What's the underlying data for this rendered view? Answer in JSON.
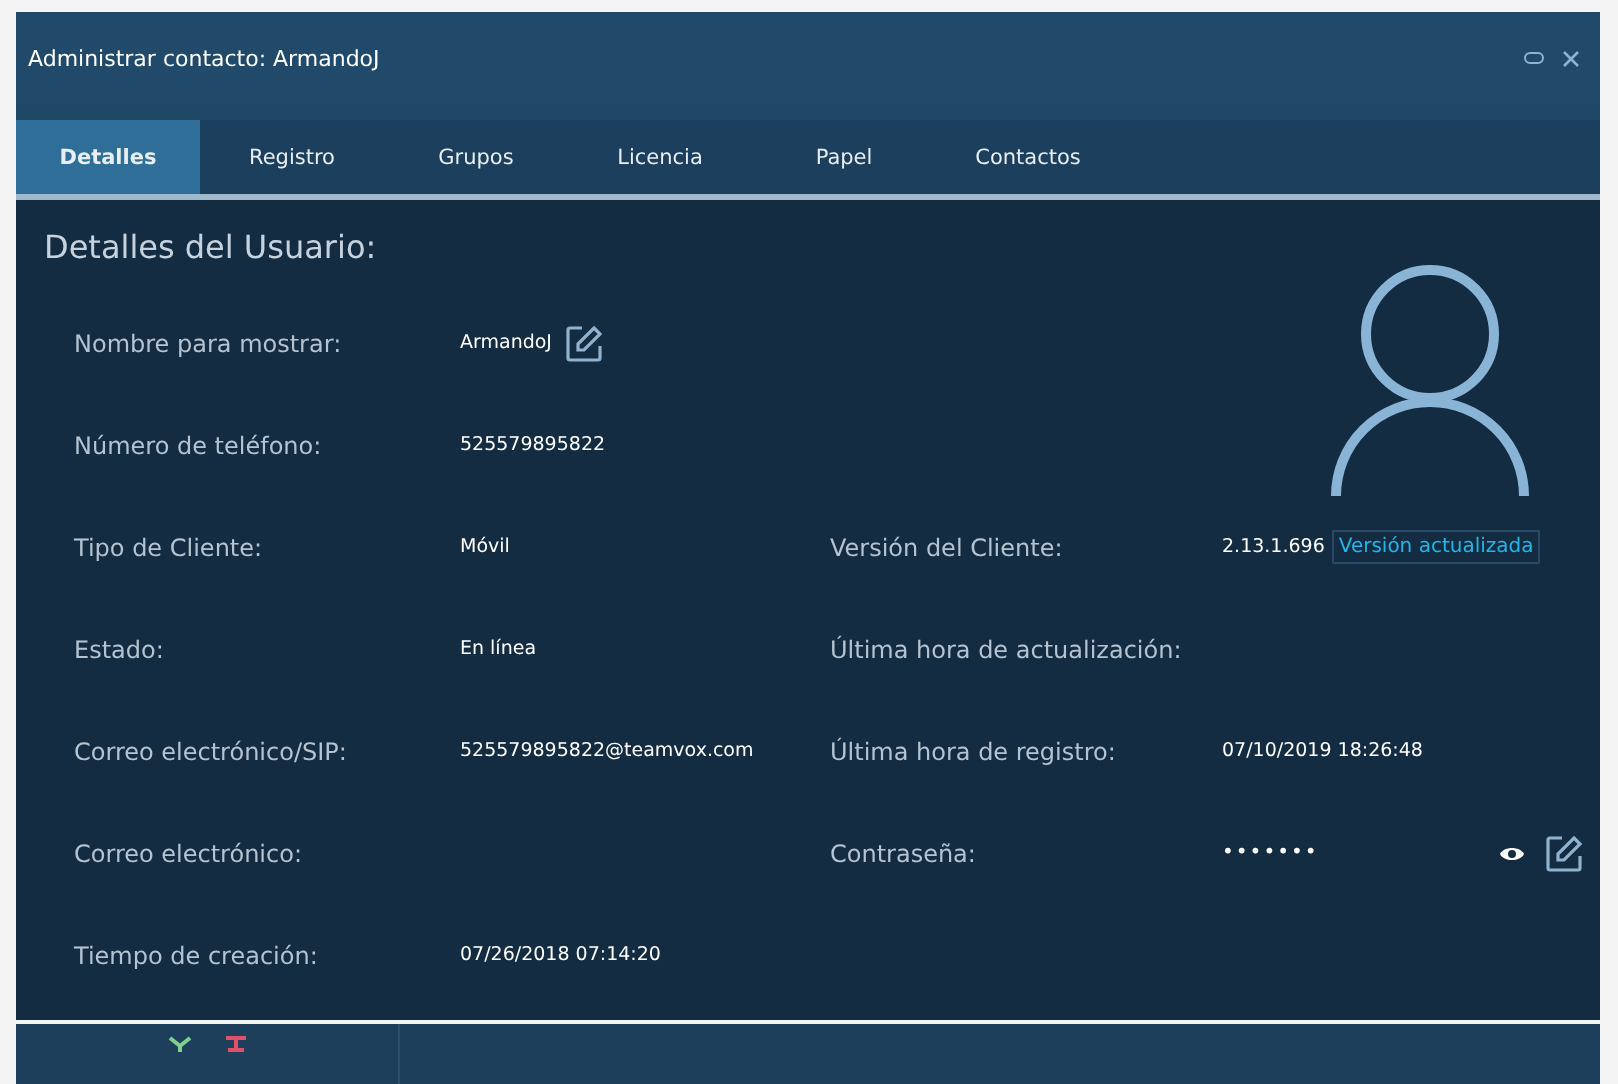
{
  "window": {
    "title": "Administrar contacto: ArmandoJ"
  },
  "tabs": [
    {
      "label": "Detalles",
      "selected": true
    },
    {
      "label": "Registro",
      "selected": false
    },
    {
      "label": "Grupos",
      "selected": false
    },
    {
      "label": "Licencia",
      "selected": false
    },
    {
      "label": "Papel",
      "selected": false
    },
    {
      "label": "Contactos",
      "selected": false
    }
  ],
  "section_title": "Detalles del Usuario:",
  "rows": [
    {
      "left": {
        "label": "Nombre para mostrar:",
        "value": "ArmandoJ",
        "editable": true
      }
    },
    {
      "left": {
        "label": "Número de teléfono:",
        "value": "525579895822"
      }
    },
    {
      "left": {
        "label": "Tipo de Cliente:",
        "value": "Móvil"
      },
      "right": {
        "label": "Versión del Cliente:",
        "value": "2.13.1.696",
        "badge": "Versión actualizada"
      }
    },
    {
      "left": {
        "label": "Estado:",
        "value": "En línea"
      },
      "right": {
        "label": "Última hora de actualización:"
      }
    },
    {
      "left": {
        "label": "Correo electrónico/SIP:",
        "value": "525579895822@teamvox.com"
      },
      "right": {
        "label": "Última hora de registro:",
        "value": "07/10/2019 18:26:48"
      }
    },
    {
      "left": {
        "label": "Correo electrónico:"
      },
      "right": {
        "label": "Contraseña:",
        "value": "•••••••",
        "revealable": true,
        "editable": true
      }
    },
    {
      "left": {
        "label": "Tiempo de creación:",
        "value": "07/26/2018 07:14:20"
      }
    }
  ]
}
